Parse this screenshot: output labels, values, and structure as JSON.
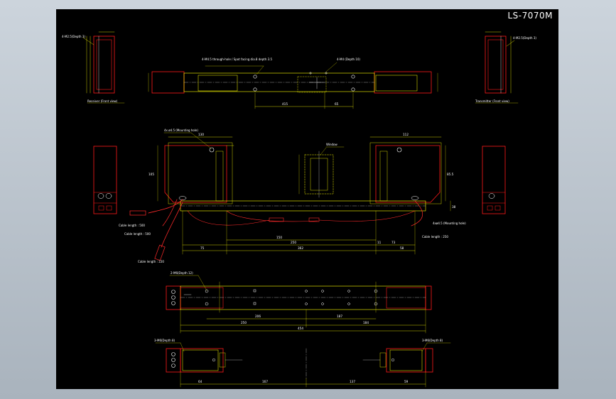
{
  "sheet": {
    "title": "LS-7070M",
    "colors": {
      "background": "#000000",
      "body_outline": "#ff1a1a",
      "dimension": "#ffff00",
      "cable": "#ff2a2a",
      "hole": "#ffffff",
      "text": "#ffffff",
      "viewport": "#b9c2cb"
    }
  },
  "views": {
    "receiver_front": {
      "caption": "Receiver (Front view)",
      "note": "4-M2.5(Depth 3)"
    },
    "transmitter_front": {
      "caption": "Transmitter (Front view)",
      "note": "4-M2.5(Depth 3)"
    },
    "top_view": {
      "note_left": "4-M4.5 through-hole / Spot facing dia.8 depth 3.5",
      "note_right": "4-M4 (Depth 10)",
      "dim_left": "415",
      "dim_right": "65"
    },
    "main_view": {
      "note_mount": "4x ø4.5 (Mounting hole)",
      "note_window": "Window",
      "note_mount_right": "4xø4.5 (Mounting hole)",
      "cable_1": "Cable length : 500",
      "cable_2": "Cable length : 500",
      "cable_3": "Cable length : 220",
      "cable_4": "Cable length : 250",
      "dim_width_l": "130",
      "dim_width_r": "112",
      "dim_h": "105",
      "dim_gap": "150",
      "dim_center": "250",
      "dim_total": "362",
      "dim_a": "75",
      "dim_b": "11",
      "dim_c": "73",
      "dim_d": "58",
      "dim_e": "38",
      "dim_f": "85.5"
    },
    "bottom_plan": {
      "note": "2-M6(Depth 12)",
      "dim_1": "206",
      "dim_2": "187",
      "dim_3": "250",
      "dim_4": "184",
      "dim_total": "454"
    },
    "side_view": {
      "note_left": "3-M6(Depth 8)",
      "note_right": "3-M6(Depth 8)",
      "dim_1": "64",
      "dim_2": "167",
      "dim_3": "137",
      "dim_4": "59"
    }
  }
}
